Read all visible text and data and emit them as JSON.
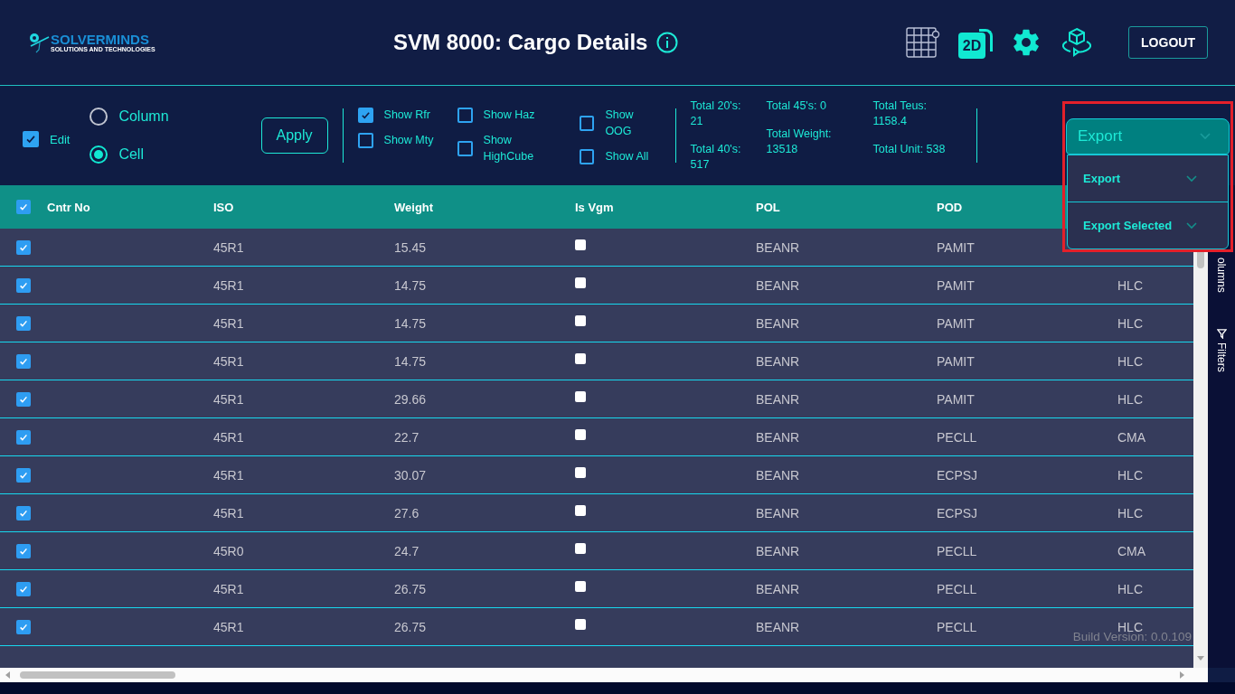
{
  "header": {
    "logo": {
      "name": "SOLVERMINDS",
      "tagline": "SOLUTIONS AND TECHNOLOGIES"
    },
    "title": "SVM 8000: Cargo Details",
    "logout": "LOGOUT",
    "view_2d": "2D"
  },
  "toolbar": {
    "edit": {
      "label": "Edit",
      "checked": true
    },
    "modes": [
      {
        "label": "Column",
        "selected": false
      },
      {
        "label": "Cell",
        "selected": true
      }
    ],
    "apply": "Apply",
    "filters": [
      {
        "label": "Show Rfr",
        "checked": true
      },
      {
        "label": "Show Mty",
        "checked": false
      },
      {
        "label": "Show Haz",
        "checked": false
      },
      {
        "label": "Show HighCube",
        "checked": false
      },
      {
        "label": "Show OOG",
        "checked": false
      },
      {
        "label": "Show All",
        "checked": false
      }
    ],
    "totals": [
      {
        "text": "Total 20's: 21"
      },
      {
        "text": "Total 40's: 517"
      },
      {
        "text": "Total 45's: 0"
      },
      {
        "text": "Total Weight: 13518"
      },
      {
        "text": "Total Teus: 1158.4"
      },
      {
        "text": "Total Unit: 538"
      }
    ],
    "export": {
      "label": "Export",
      "expanded": true,
      "highlighted": true,
      "items": [
        "Export",
        "Export Selected"
      ]
    }
  },
  "table": {
    "all_selected": true,
    "columns": [
      "Cntr No",
      "ISO",
      "Weight",
      "Is Vgm",
      "POL",
      "POD"
    ],
    "rows": [
      {
        "selected": true,
        "cells": [
          "",
          "45R1",
          "15.45",
          "",
          "BEANR",
          "PAMIT"
        ],
        "is_vgm": false
      },
      {
        "selected": true,
        "cells": [
          "",
          "45R1",
          "14.75",
          "",
          "BEANR",
          "PAMIT",
          "HLC"
        ],
        "is_vgm": false
      },
      {
        "selected": true,
        "cells": [
          "",
          "45R1",
          "14.75",
          "",
          "BEANR",
          "PAMIT",
          "HLC"
        ],
        "is_vgm": false
      },
      {
        "selected": true,
        "cells": [
          "",
          "45R1",
          "14.75",
          "",
          "BEANR",
          "PAMIT",
          "HLC"
        ],
        "is_vgm": false
      },
      {
        "selected": true,
        "cells": [
          "",
          "45R1",
          "29.66",
          "",
          "BEANR",
          "PAMIT",
          "HLC"
        ],
        "is_vgm": false
      },
      {
        "selected": true,
        "cells": [
          "",
          "45R1",
          "22.7",
          "",
          "BEANR",
          "PECLL",
          "CMA"
        ],
        "is_vgm": false
      },
      {
        "selected": true,
        "cells": [
          "",
          "45R1",
          "30.07",
          "",
          "BEANR",
          "ECPSJ",
          "HLC"
        ],
        "is_vgm": false
      },
      {
        "selected": true,
        "cells": [
          "",
          "45R1",
          "27.6",
          "",
          "BEANR",
          "ECPSJ",
          "HLC"
        ],
        "is_vgm": false
      },
      {
        "selected": true,
        "cells": [
          "",
          "45R0",
          "24.7",
          "",
          "BEANR",
          "PECLL",
          "CMA"
        ],
        "is_vgm": false
      },
      {
        "selected": true,
        "cells": [
          "",
          "45R1",
          "26.75",
          "",
          "BEANR",
          "PECLL",
          "HLC"
        ],
        "is_vgm": false
      },
      {
        "selected": true,
        "cells": [
          "",
          "45R1",
          "26.75",
          "",
          "BEANR",
          "PECLL",
          "HLC"
        ],
        "is_vgm": false
      }
    ]
  },
  "side_panel": [
    {
      "kind": "columns",
      "label": "olumns"
    },
    {
      "kind": "filters",
      "label": "Filters"
    }
  ],
  "build_version": "Build Version: 0.0.109"
}
